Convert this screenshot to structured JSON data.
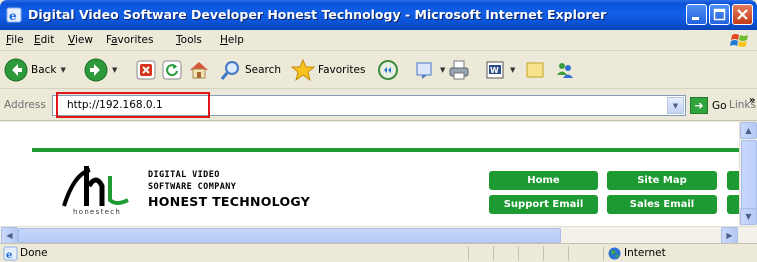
{
  "window": {
    "title": "Digital Video Software Developer Honest Technology - Microsoft Internet Explorer"
  },
  "menu": {
    "items": [
      {
        "label": "File",
        "underline": "F",
        "rest": "ile"
      },
      {
        "label": "Edit",
        "underline": "E",
        "rest": "dit"
      },
      {
        "label": "View",
        "underline": "V",
        "rest": "iew"
      },
      {
        "label": "Favorites",
        "pre": "F",
        "underline": "a",
        "rest": "vorites"
      },
      {
        "label": "Tools",
        "underline": "T",
        "rest": "ools"
      },
      {
        "label": "Help",
        "underline": "H",
        "rest": "elp"
      }
    ]
  },
  "toolbar": {
    "back_label": "Back",
    "search_label": "Search",
    "favorites_label": "Favorites"
  },
  "address": {
    "label": "Address",
    "url": "http://192.168.0.1",
    "go_label": "Go",
    "links_label": "Links",
    "links_chevron": "»"
  },
  "page": {
    "logo_text": "honestech",
    "company_line1": "DIGITAL VIDEO",
    "company_line2": "SOFTWARE COMPANY",
    "company_line3": "HONEST TECHNOLOGY",
    "nav": {
      "home": "Home",
      "site_map": "Site Map",
      "support_email": "Support Email",
      "sales_email": "Sales Email"
    },
    "accent_color": "#1d9a31"
  },
  "status": {
    "text": "Done",
    "zone": "Internet"
  },
  "colors": {
    "titlebar": "#0a52d8",
    "highlight_box": "#e0161b",
    "chrome": "#ece9d8"
  }
}
